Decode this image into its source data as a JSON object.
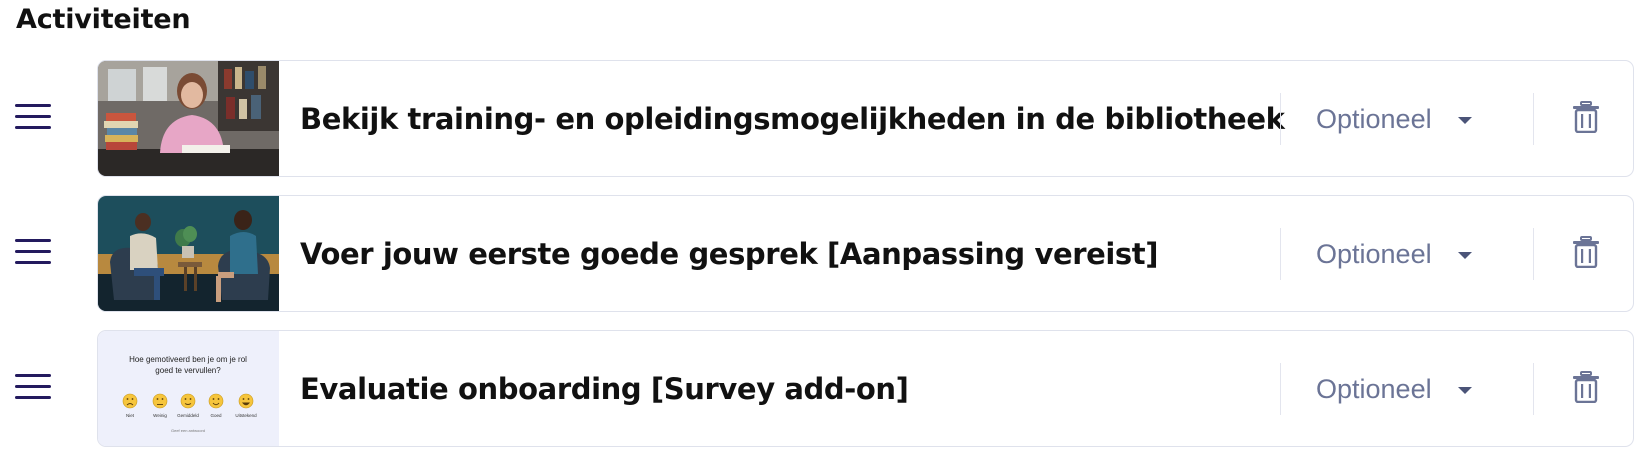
{
  "section": {
    "title": "Activiteiten"
  },
  "activities": [
    {
      "title": "Bekijk training- en opleidingsmogelijkheden in de bibliotheek",
      "mode": "Optioneel"
    },
    {
      "title": "Voer jouw eerste goede gesprek [Aanpassing vereist]",
      "mode": "Optioneel"
    },
    {
      "title": "Evaluatie onboarding [Survey add-on]",
      "mode": "Optioneel"
    }
  ],
  "survey_thumbnail": {
    "question_line1": "Hoe gemotiveerd ben je om je rol",
    "question_line2": "goed te vervullen?",
    "options": [
      "Niet",
      "Weinig",
      "Gemiddeld",
      "Goed",
      "Uitstekend"
    ],
    "footer": "Geef een antwoord"
  },
  "icons": {
    "drag": "drag-handle-icon",
    "dropdown": "caret-down-icon",
    "delete": "trash-icon"
  },
  "colors": {
    "drag_handle": "#231a5e",
    "dropdown_text": "#6b7496",
    "trash": "#6b7496",
    "card_border": "#dfe2ec",
    "survey_bg": "#eef0fb"
  }
}
